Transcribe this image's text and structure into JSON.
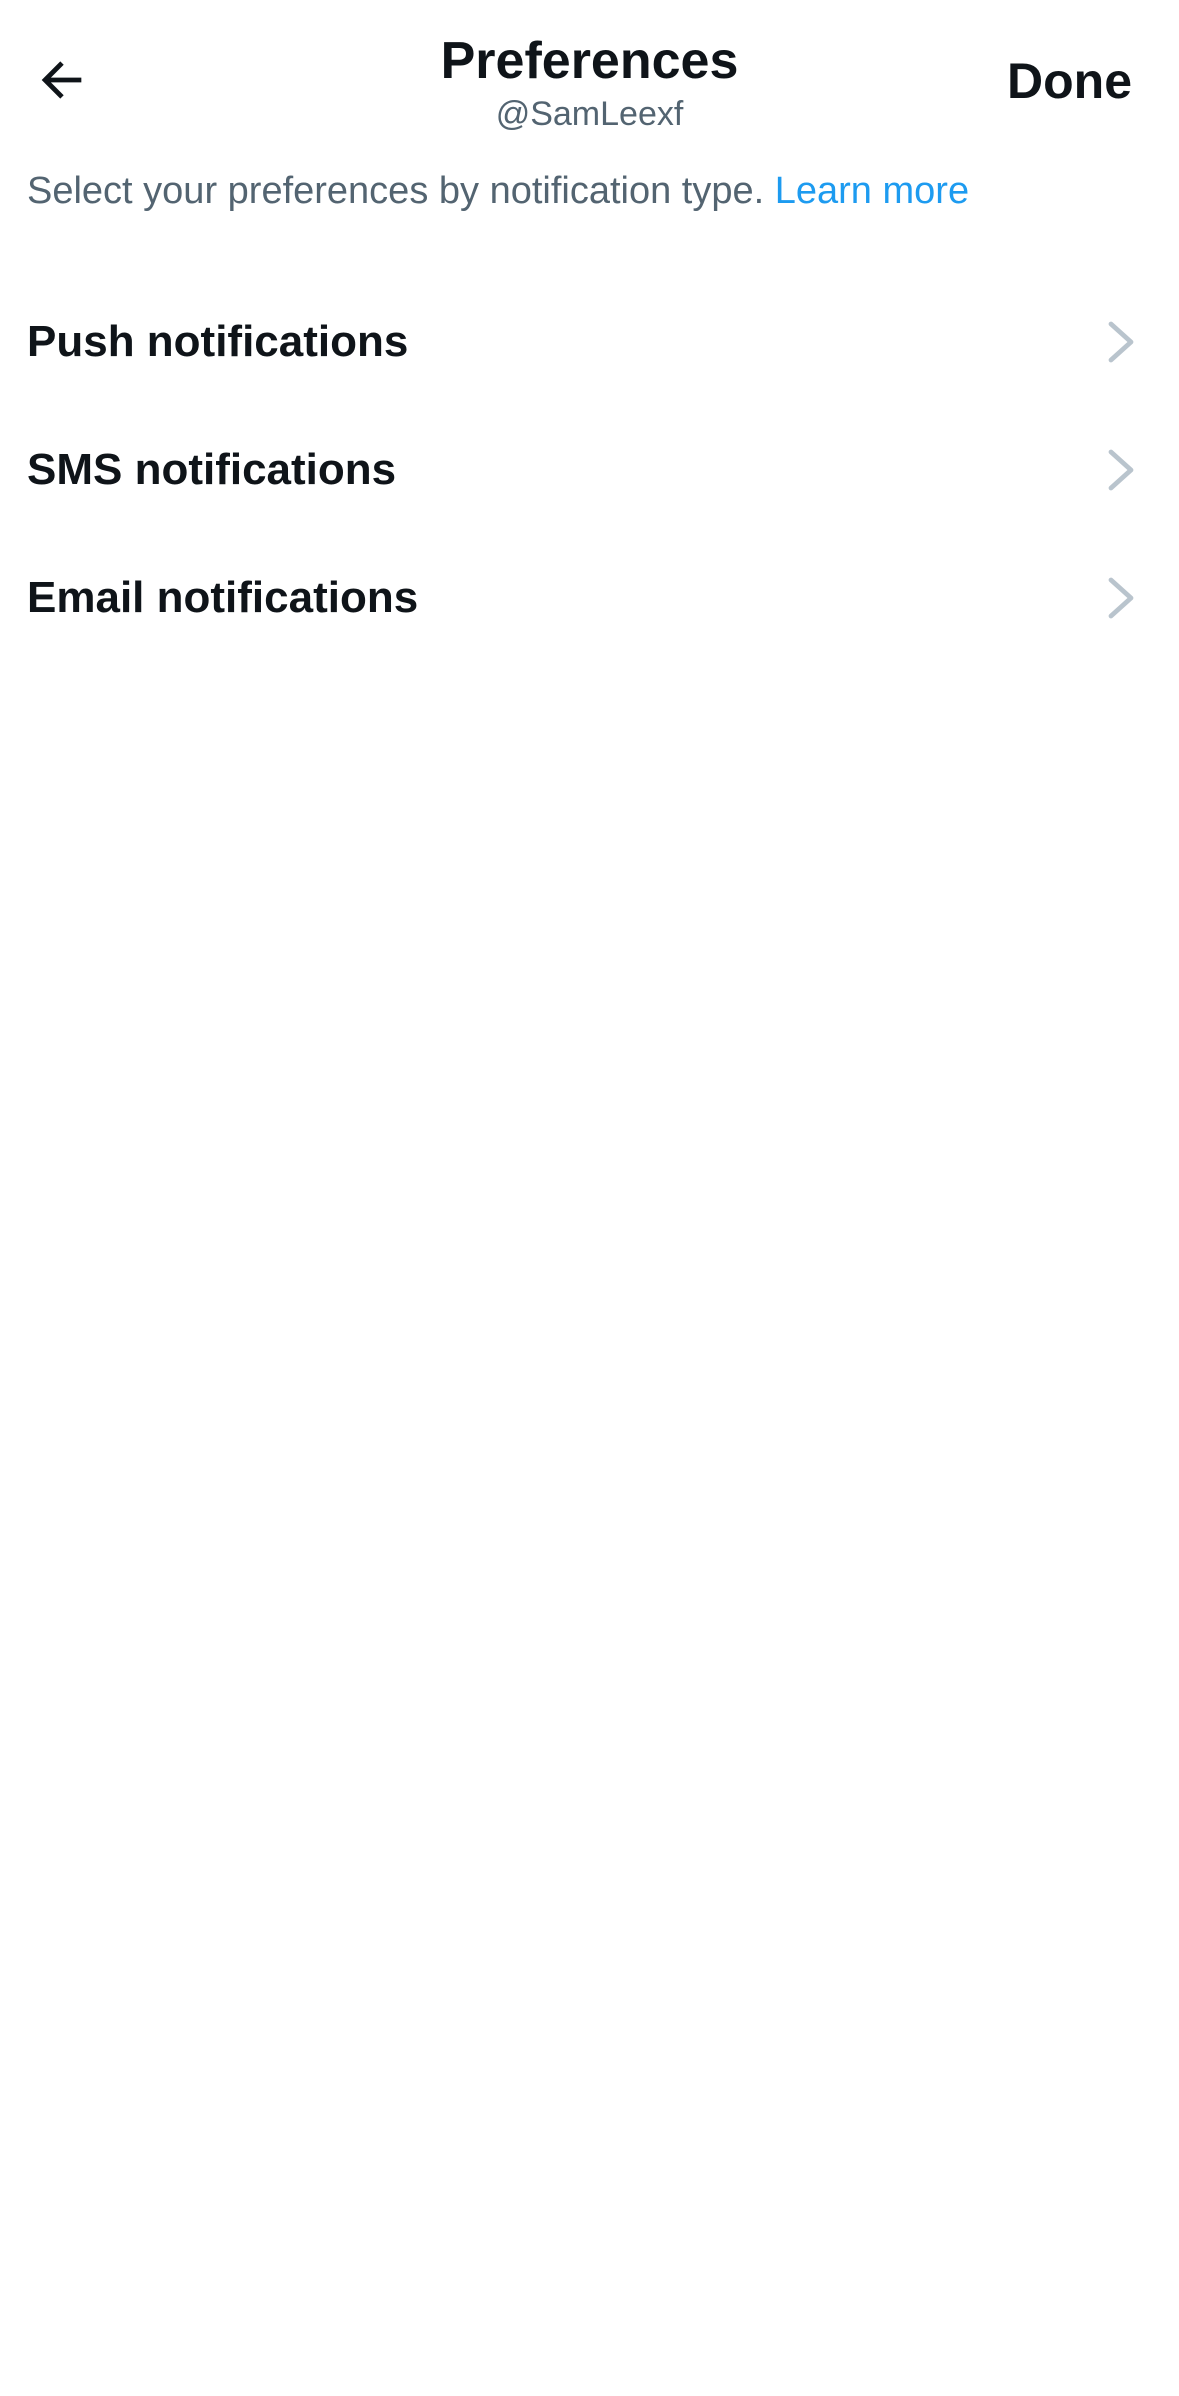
{
  "header": {
    "back_icon": "arrow-left-icon",
    "title": "Preferences",
    "subtitle": "@SamLeexf",
    "done_label": "Done"
  },
  "description": {
    "text": "Select your preferences by notification type. ",
    "link_label": "Learn more"
  },
  "items": [
    {
      "label": "Push notifications",
      "icon": "chevron-right-icon"
    },
    {
      "label": "SMS notifications",
      "icon": "chevron-right-icon"
    },
    {
      "label": "Email notifications",
      "icon": "chevron-right-icon"
    }
  ],
  "colors": {
    "text_primary": "#0f1419",
    "text_secondary": "#536471",
    "link": "#1d9bf0",
    "chevron": "#b9c4cd",
    "background": "#ffffff"
  }
}
